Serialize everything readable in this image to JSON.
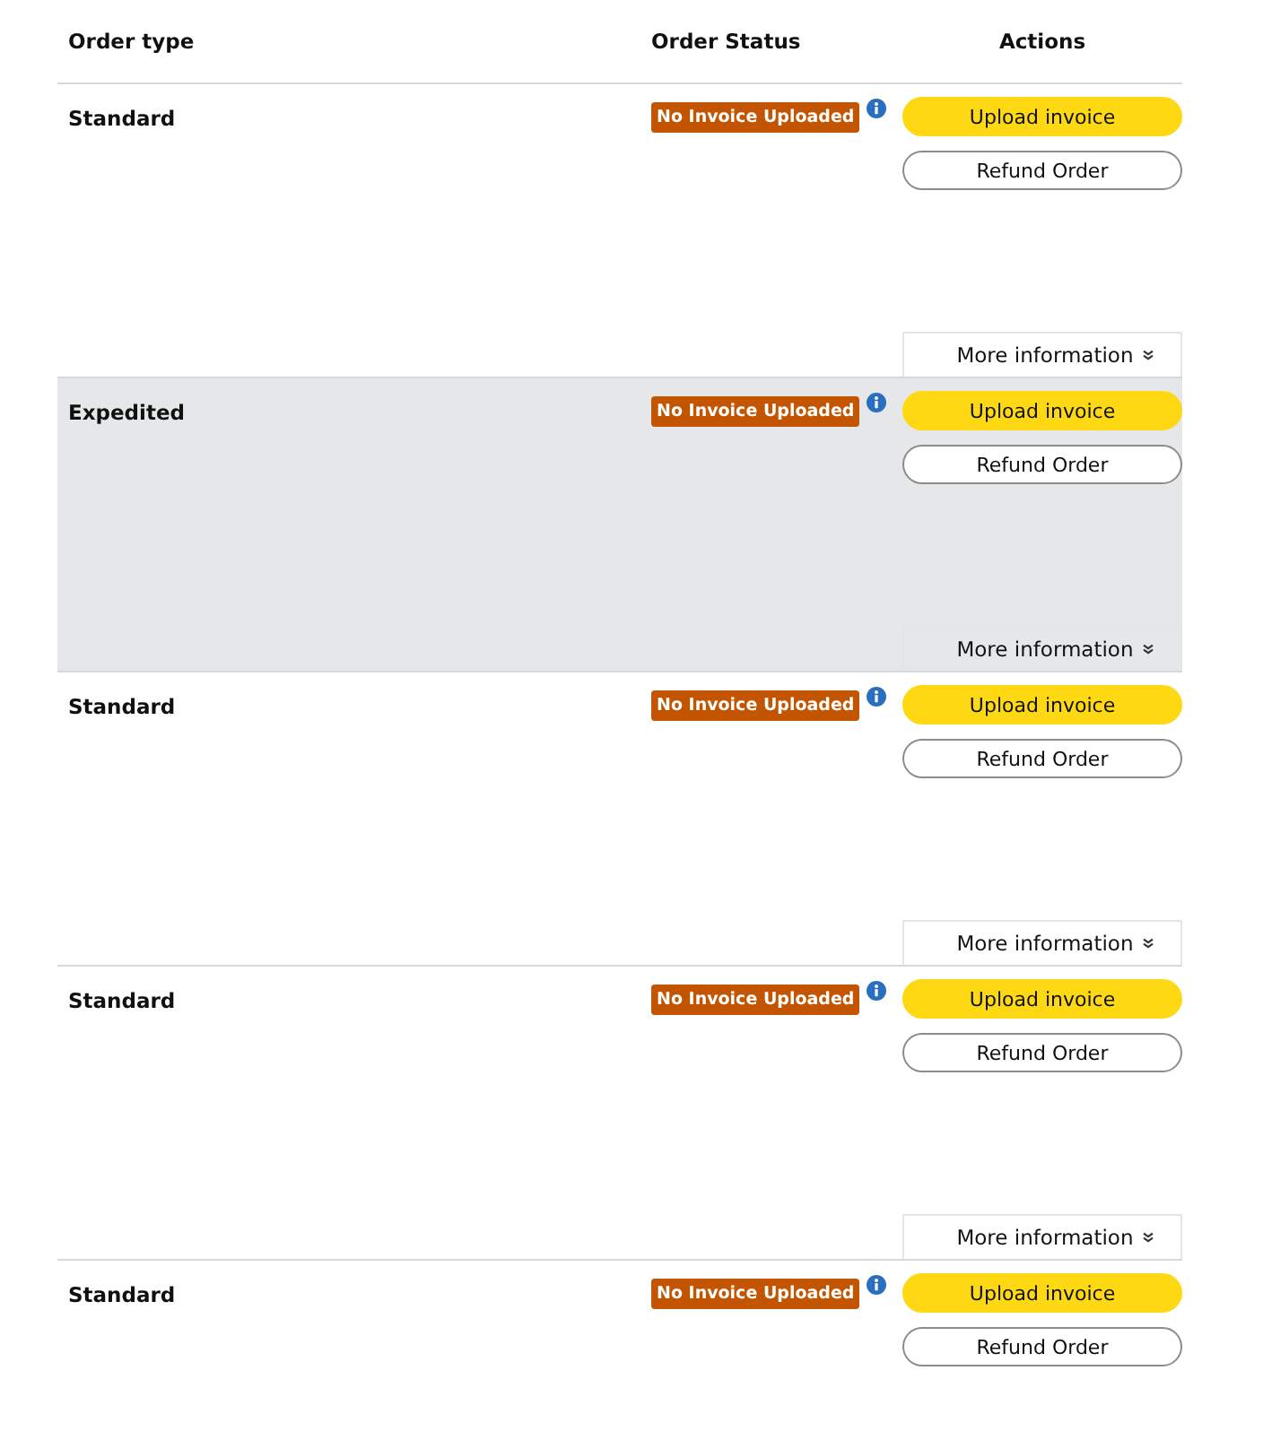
{
  "columns": [
    "Order type",
    "Order Status",
    "Actions"
  ],
  "rows": [
    {
      "order_type": "Standard",
      "status": "No Invoice Uploaded",
      "selected": false,
      "upload": "Upload invoice",
      "refund": "Refund Order",
      "more": "More information"
    },
    {
      "order_type": "Expedited",
      "status": "No Invoice Uploaded",
      "selected": true,
      "upload": "Upload invoice",
      "refund": "Refund Order",
      "more": "More information"
    },
    {
      "order_type": "Standard",
      "status": "No Invoice Uploaded",
      "selected": false,
      "upload": "Upload invoice",
      "refund": "Refund Order",
      "more": "More information"
    },
    {
      "order_type": "Standard",
      "status": "No Invoice Uploaded",
      "selected": false,
      "upload": "Upload invoice",
      "refund": "Refund Order",
      "more": "More information"
    },
    {
      "order_type": "Standard",
      "status": "No Invoice Uploaded",
      "selected": false,
      "upload": "Upload invoice",
      "refund": "Refund Order"
    }
  ]
}
